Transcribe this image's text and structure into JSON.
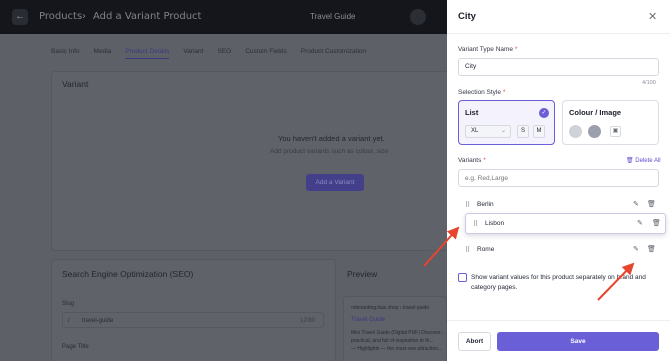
{
  "background": {
    "back_glyph": "←",
    "breadcrumb": [
      "Products",
      "Add a Variant Product"
    ],
    "breadcrumb_separator": "›",
    "product_title": "Travel Guide",
    "tabs": [
      "Basic Info",
      "Media",
      "Product Details",
      "Variant",
      "SEO",
      "Custom Fields",
      "Product Customization"
    ],
    "active_tab": "Product Details",
    "variant_heading": "Variant",
    "empty_title": "You haven't added a variant yet.",
    "empty_subtitle": "Add product variants such as colour, size",
    "add_variant_label": "Add a Variant",
    "seo_heading": "Search Engine Optimization (SEO)",
    "preview_heading": "Preview",
    "slug_label": "Slug",
    "slug_prefix": "/",
    "slug_value": "travel-guide",
    "slug_counter": "12/80",
    "page_title_label": "Page Title",
    "preview_url": "onboarding.ikas.shop › travel-guide",
    "preview_title": "Travel Guide",
    "preview_desc1": "Mini Travel Guide (Digital PDF) Discover...",
    "preview_desc2": "practical, and full of inspiration to th...",
    "preview_desc3": "— Highlights — the must-see attraction..."
  },
  "panel": {
    "title": "City",
    "close_icon": "close-icon",
    "variant_type_name_label": "Variant Type Name",
    "variant_type_name_value": "City",
    "char_counter": "4/100",
    "selection_style_label": "Selection Style",
    "style_list": {
      "title": "List",
      "selected": true,
      "size_value": "XL",
      "chips": [
        "S",
        "M"
      ]
    },
    "style_colour": {
      "title": "Colour / Image",
      "swatches": [
        "#cfd2d9",
        "#9a9ead"
      ]
    },
    "variants_label": "Variants",
    "variants_placeholder": "e.g. Red,Large",
    "delete_all_label": "Delete All",
    "variants": [
      "Berlin",
      "Lisbon",
      "Rome"
    ],
    "dragging_index": 1,
    "checkbox_text": "Show variant values for this product separately on brand and category pages.",
    "checkbox_checked": false,
    "abort_label": "Abort",
    "save_label": "Save"
  },
  "colors": {
    "accent": "#6a5fd6",
    "annotation_arrow": "#e8452e"
  }
}
